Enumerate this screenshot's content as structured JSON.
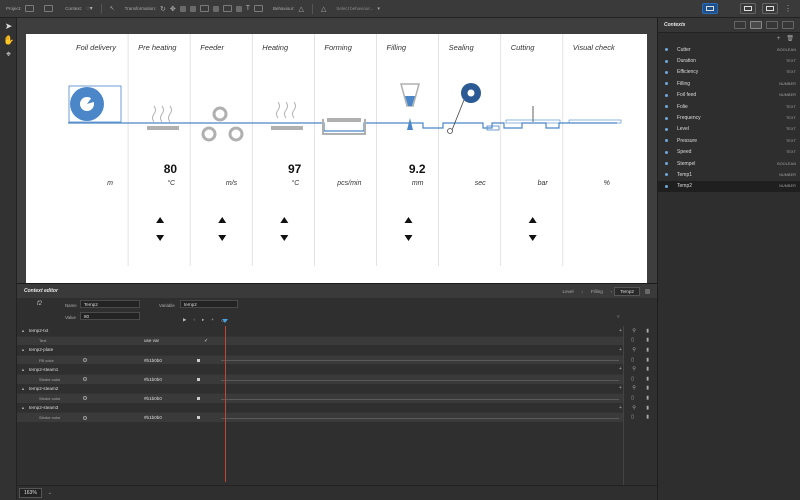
{
  "toolbar": {
    "project_label": "Project:",
    "context_label": "Context:",
    "transformation_label": "Transformation:",
    "behaviour_label": "Behaviour:",
    "select_behaviour": "Select behaviour..."
  },
  "process": {
    "stations": [
      {
        "label": "Foil delivery",
        "value": "",
        "unit": "m"
      },
      {
        "label": "Pre heating",
        "value": "80",
        "unit": "°C"
      },
      {
        "label": "Feeder",
        "value": "",
        "unit": "m/s"
      },
      {
        "label": "Heating",
        "value": "97",
        "unit": "°C"
      },
      {
        "label": "Forming",
        "value": "",
        "unit": "pcs/min"
      },
      {
        "label": "Filling",
        "value": "9.2",
        "unit": "mm"
      },
      {
        "label": "Sealing",
        "value": "",
        "unit": "sec"
      },
      {
        "label": "Cutting",
        "value": "",
        "unit": "bar"
      },
      {
        "label": "Visual check",
        "value": "",
        "unit": "%"
      }
    ]
  },
  "contexts_panel": {
    "title": "Contexts",
    "items": [
      {
        "name": "Cutter",
        "type": "BOOLEAN",
        "selected": false
      },
      {
        "name": "Duration",
        "type": "TEXT",
        "selected": false
      },
      {
        "name": "Efficiency",
        "type": "TEXT",
        "selected": false
      },
      {
        "name": "Filling",
        "type": "NUMBER",
        "selected": false
      },
      {
        "name": "Foil feed",
        "type": "NUMBER",
        "selected": false
      },
      {
        "name": "Folie",
        "type": "TEXT",
        "selected": false
      },
      {
        "name": "Frequency",
        "type": "TEXT",
        "selected": false
      },
      {
        "name": "Level",
        "type": "TEXT",
        "selected": false
      },
      {
        "name": "Pressure",
        "type": "TEXT",
        "selected": false
      },
      {
        "name": "Speed",
        "type": "TEXT",
        "selected": false
      },
      {
        "name": "Stempel",
        "type": "BOOLEAN",
        "selected": false
      },
      {
        "name": "Temp1",
        "type": "NUMBER",
        "selected": false
      },
      {
        "name": "Temp2",
        "type": "NUMBER",
        "selected": true
      }
    ]
  },
  "editor": {
    "title": "Context editor",
    "breadcrumb": [
      "Level",
      "Filling",
      "Temp2"
    ],
    "fx": "f2",
    "name_label": "Name",
    "name_value": "Temp2",
    "variable_label": "Variable",
    "variable_value": "temp2",
    "value_label": "Value",
    "value_value": "80",
    "rows": [
      {
        "kind": "group",
        "name": "temp2-txt"
      },
      {
        "kind": "prop",
        "name": "Text",
        "value": "use var",
        "check": "✓"
      },
      {
        "kind": "group",
        "name": "temp2-plate"
      },
      {
        "kind": "prop",
        "name": "Fill color",
        "value": "#b1b0b0",
        "check": ""
      },
      {
        "kind": "group",
        "name": "temp2-steam1"
      },
      {
        "kind": "prop",
        "name": "Stroke color",
        "value": "#b1b0b0",
        "check": ""
      },
      {
        "kind": "group",
        "name": "temp2-steam2"
      },
      {
        "kind": "prop",
        "name": "Stroke color",
        "value": "#b1b0b0",
        "check": ""
      },
      {
        "kind": "group",
        "name": "temp2-steam3"
      },
      {
        "kind": "prop",
        "name": "Stroke color",
        "value": "#b1b0b0",
        "check": ""
      }
    ]
  },
  "zoom": "163%",
  "colors": {
    "accent": "#4a86c8",
    "grey_part": "#b1b0b0",
    "playhead": "#c0463a"
  }
}
